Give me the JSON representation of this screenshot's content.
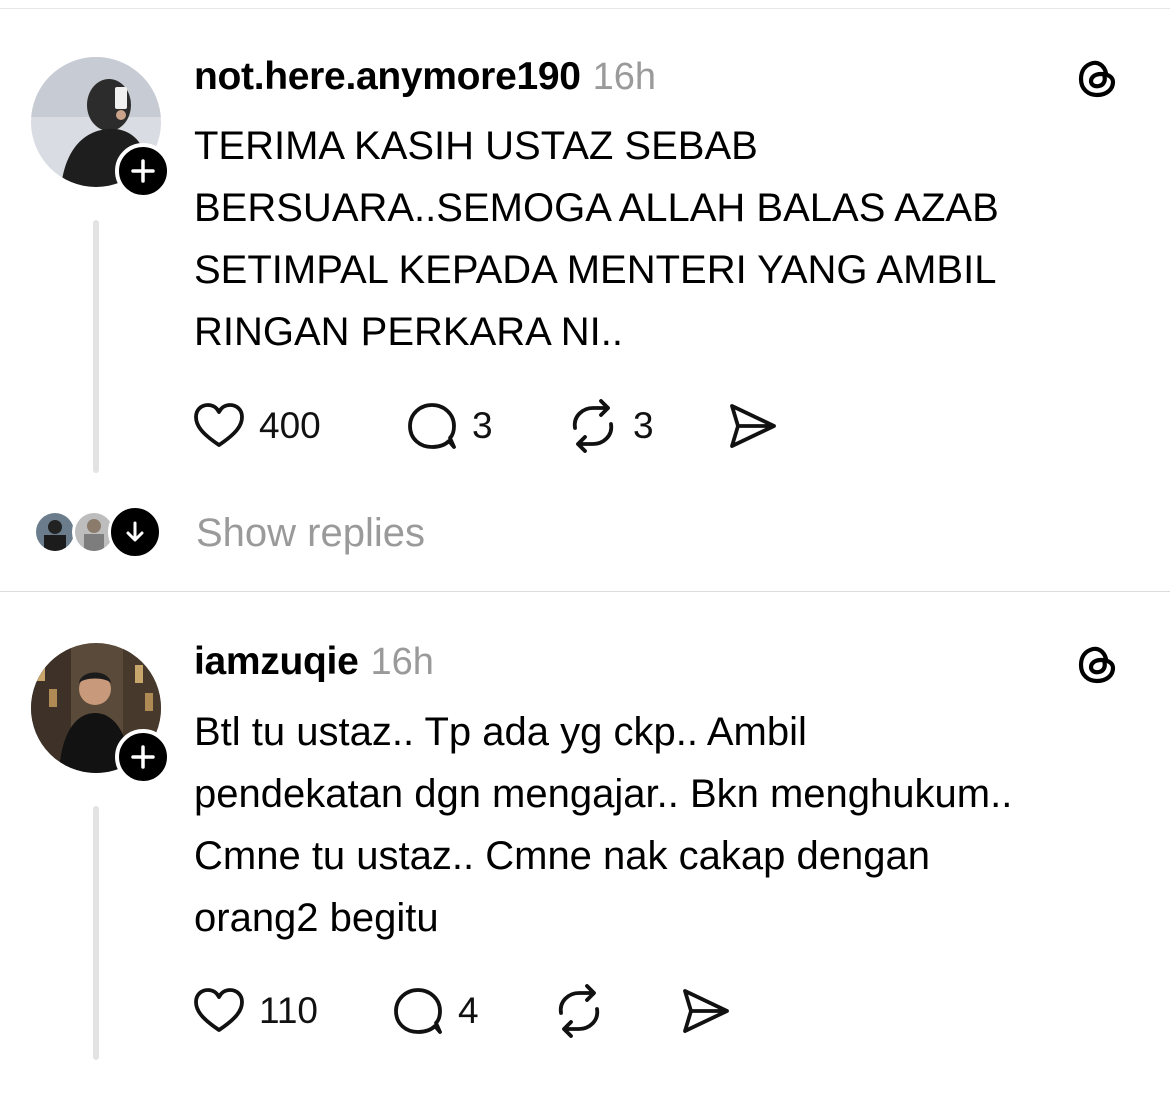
{
  "posts": [
    {
      "username": "not.here.anymore190",
      "time": "16h",
      "text": "TERIMA KASIH USTAZ SEBAB\nBERSUARA..SEMOGA ALLAH BALAS AZAB\nSETIMPAL KEPADA MENTERI YANG AMBIL\nRINGAN PERKARA NI..",
      "likes": "400",
      "comments": "3",
      "reposts": "3",
      "show_replies": "Show replies",
      "icons": {
        "like": "heart-icon",
        "comment": "comment-bubble-icon",
        "repost": "repost-icon",
        "share": "send-icon",
        "brand": "threads-logo-icon"
      }
    },
    {
      "username": "iamzuqie",
      "time": "16h",
      "text": "Btl tu ustaz.. Tp ada yg ckp.. Ambil\npendekatan dgn mengajar.. Bkn menghukum..\nCmne tu ustaz.. Cmne nak cakap dengan\norang2 begitu",
      "likes": "110",
      "comments": "4",
      "reposts": "",
      "icons": {
        "like": "heart-icon",
        "comment": "comment-bubble-icon",
        "repost": "repost-icon",
        "share": "send-icon",
        "brand": "threads-logo-icon"
      }
    }
  ],
  "colors": {
    "text": "#000000",
    "muted": "#9a9a9a",
    "divider": "#dcdcdc",
    "thread_line": "#e3e3e3"
  }
}
